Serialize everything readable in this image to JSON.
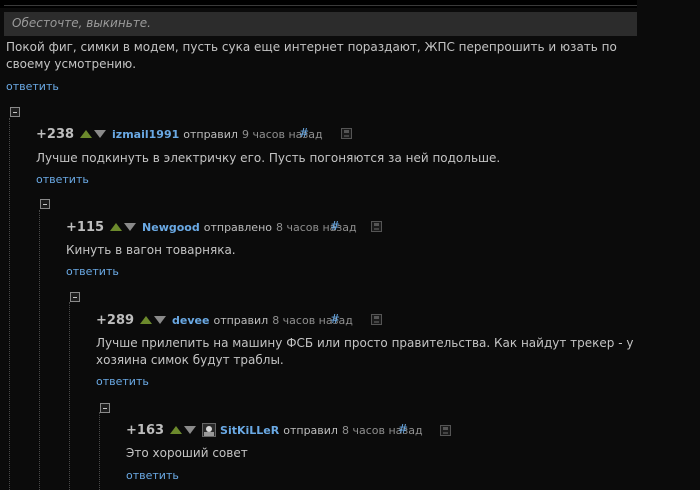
{
  "quote": {
    "text": "Обесточте, выкиньте."
  },
  "root": {
    "text": "Покой фиг, симки в модем, пусть сука еще интернет пораздают, ЖПС перепрошить и юзать по своему усмотрению.",
    "reply_label": "ответить"
  },
  "comments": [
    {
      "score": "+238",
      "author": "izmail1991",
      "action": "отправил",
      "time": "9 часов назад",
      "permalink": "#",
      "text": "Лучше подкинуть в электричку его. Пусть погоняются за ней подольше.",
      "reply_label": "ответить"
    },
    {
      "score": "+115",
      "author": "Newgood",
      "action": "отправлено",
      "time": "8 часов назад",
      "permalink": "#",
      "text": "Кинуть в вагон товарняка.",
      "reply_label": "ответить"
    },
    {
      "score": "+289",
      "author": "devee",
      "action": "отправил",
      "time": "8 часов назад",
      "permalink": "#",
      "text": "Лучше прилепить на машину ФСБ или просто правительства. Как найдут трекер - у хозяина симок будут траблы.",
      "reply_label": "ответить"
    },
    {
      "score": "+163",
      "author": "SitKiLLeR",
      "action": "отправил",
      "time": "8 часов назад",
      "permalink": "#",
      "text": "Это хороший совет",
      "reply_label": "ответить"
    }
  ],
  "colors": {
    "background": "#0b0b0b",
    "link": "#6aa9e4",
    "vote_up": "#6c8a2c",
    "vote_down": "#8a8a8a"
  },
  "icons": [
    "collapse-icon",
    "upvote-icon",
    "downvote-icon",
    "avatar-icon",
    "save-icon"
  ]
}
